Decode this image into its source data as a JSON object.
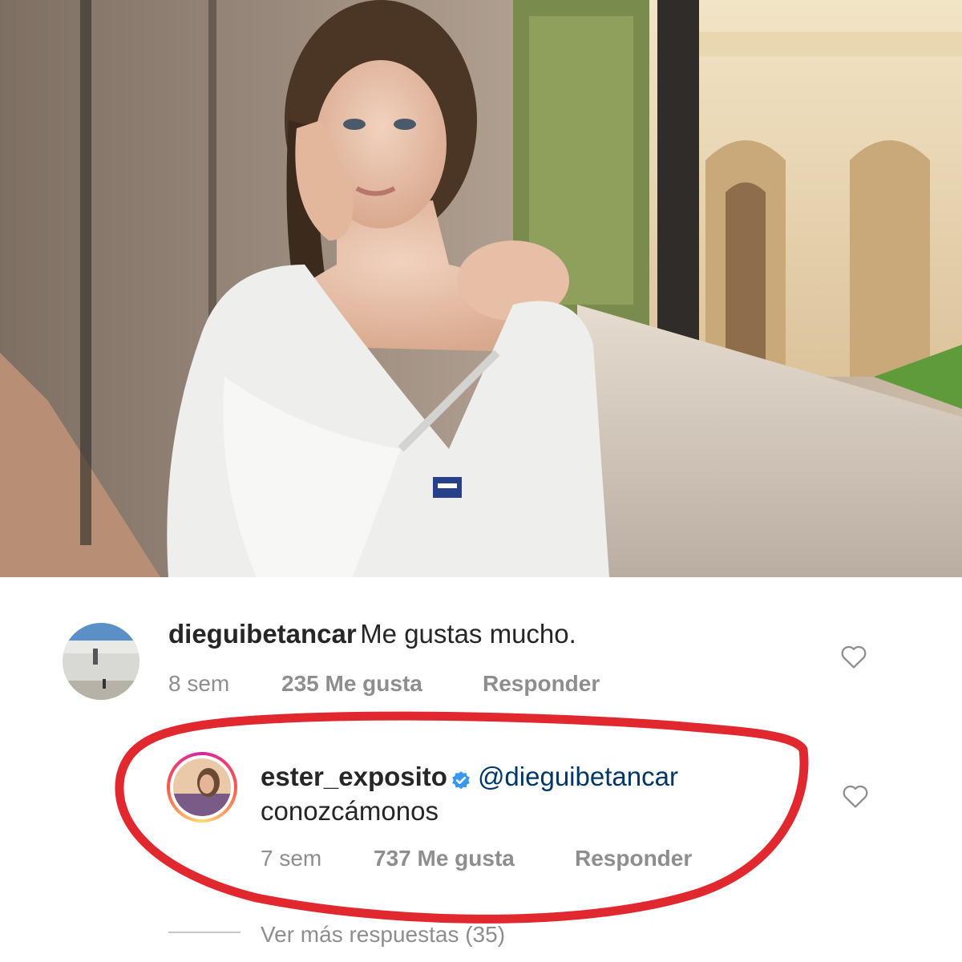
{
  "post": {
    "image_alt": "photo of a woman in a white bathrobe beside a window overlooking a stone cloister"
  },
  "comments": [
    {
      "username": "dieguibetancar",
      "text": "Me gustas mucho.",
      "time": "8 sem",
      "likes": "235 Me gusta",
      "reply_label": "Responder"
    }
  ],
  "reply": {
    "username": "ester_exposito",
    "verified": true,
    "mention": "@dieguibetancar",
    "text": "conozcámonos",
    "time": "7 sem",
    "likes": "737 Me gusta",
    "reply_label": "Responder"
  },
  "view_more": "Ver más respuestas (35)",
  "colors": {
    "highlight_circle": "#e0282e",
    "mention": "#00376b",
    "verified": "#3897f0",
    "meta_text": "#8e8e8e"
  }
}
